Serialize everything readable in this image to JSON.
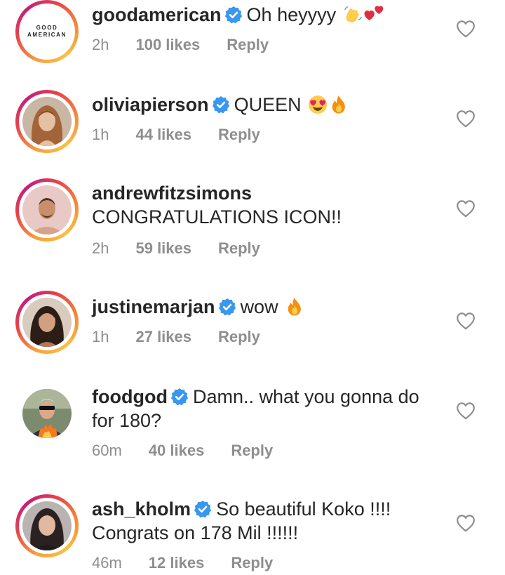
{
  "comments": [
    {
      "username": "goodamerican",
      "verified": true,
      "text": "Oh heyyyy",
      "emojis": [
        "waving-hand-emoji",
        "two-hearts-emoji"
      ],
      "time": "2h",
      "likes": "100 likes",
      "reply": "Reply",
      "avatar_logo_line1": "GOOD",
      "avatar_logo_line2": "AMERICAN"
    },
    {
      "username": "oliviapierson",
      "verified": true,
      "text": "QUEEN",
      "emojis": [
        "heart-eyes-emoji",
        "fire-emoji"
      ],
      "time": "1h",
      "likes": "44 likes",
      "reply": "Reply"
    },
    {
      "username": "andrewfitzsimons",
      "verified": false,
      "text": "CONGRATULATIONS ICON!!",
      "emojis": [],
      "time": "2h",
      "likes": "59 likes",
      "reply": "Reply"
    },
    {
      "username": "justinemarjan",
      "verified": true,
      "text": "wow",
      "emojis": [
        "fire-emoji"
      ],
      "time": "1h",
      "likes": "27 likes",
      "reply": "Reply"
    },
    {
      "username": "foodgod",
      "verified": true,
      "text_line1": "Damn.. what you gonna do",
      "text_line2": "for 180?",
      "emojis": [],
      "time": "60m",
      "likes": "40 likes",
      "reply": "Reply"
    },
    {
      "username": "ash_kholm",
      "verified": true,
      "text_line1": "So beautiful Koko !!!!",
      "text_line2": "Congrats on 178 Mil !!!!!!",
      "emojis": [],
      "time": "46m",
      "likes": "12 likes",
      "reply": "Reply"
    }
  ],
  "colors": {
    "verified_badge": "#3897f0",
    "meta_text": "#8e8e8e",
    "username_text": "#262626",
    "heart_outline": "#8e8e8e"
  }
}
